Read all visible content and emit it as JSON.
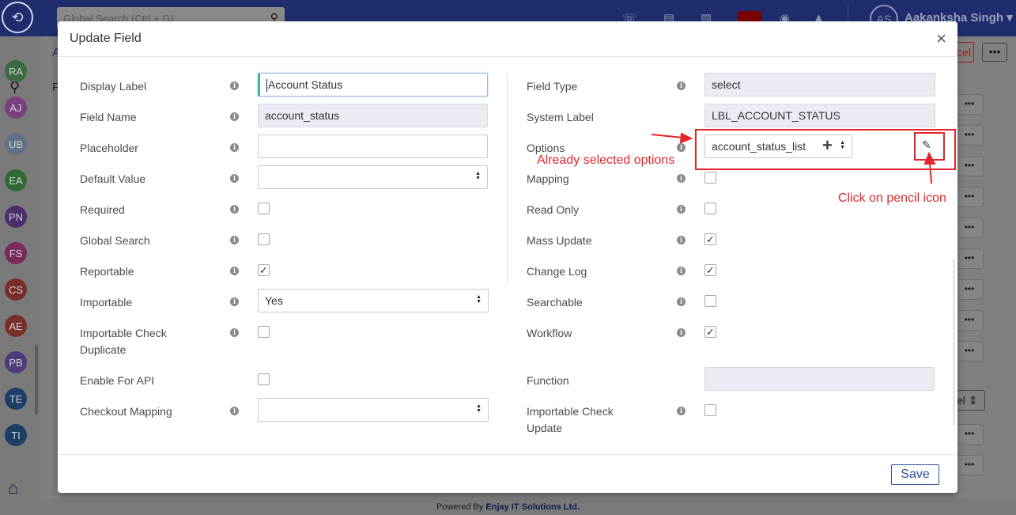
{
  "app": {
    "search_placeholder": "Global Search (Ctrl + G)",
    "user_initials": "AS",
    "user_name": "Aakanksha Singh",
    "footer_prefix": "Powered By",
    "footer_company": "Enjay IT Solutions Ltd.",
    "bg_tab_partial": "A",
    "bg_title_partial": "F",
    "bg_cancel_partial": "cel",
    "bg_select_partial": "el",
    "sidebar_avatars": [
      {
        "initials": "RA",
        "color": "#3b6b43"
      },
      {
        "initials": "AJ",
        "color": "#7a3f7e"
      },
      {
        "initials": "UB",
        "color": "#5f7186"
      },
      {
        "initials": "EA",
        "color": "#2f6a35"
      },
      {
        "initials": "PN",
        "color": "#4e2d6b"
      },
      {
        "initials": "FS",
        "color": "#7a2a5c"
      },
      {
        "initials": "CS",
        "color": "#7a2e2a"
      },
      {
        "initials": "AE",
        "color": "#7a2e2a"
      },
      {
        "initials": "PB",
        "color": "#4e3a7a"
      },
      {
        "initials": "TE",
        "color": "#1d3f66"
      },
      {
        "initials": "TI",
        "color": "#1d3f66"
      }
    ]
  },
  "modal": {
    "title": "Update Field",
    "close_symbol": "×",
    "save_label": "Save",
    "left_fields": {
      "display_label": {
        "label": "Display Label",
        "value": "Account Status"
      },
      "field_name": {
        "label": "Field Name",
        "value": "account_status"
      },
      "placeholder": {
        "label": "Placeholder",
        "value": ""
      },
      "default_value": {
        "label": "Default Value",
        "value": ""
      },
      "required": {
        "label": "Required",
        "checked": false
      },
      "global_search": {
        "label": "Global Search",
        "checked": false
      },
      "reportable": {
        "label": "Reportable",
        "checked": true
      },
      "importable": {
        "label": "Importable",
        "value": "Yes"
      },
      "importable_check_duplicate": {
        "label_line1": "Importable Check",
        "label_line2": "Duplicate",
        "checked": false
      },
      "enable_for_api": {
        "label": "Enable For API",
        "checked": false
      },
      "checkout_mapping": {
        "label": "Checkout Mapping",
        "value": ""
      }
    },
    "right_fields": {
      "field_type": {
        "label": "Field Type",
        "value": "select"
      },
      "system_label": {
        "label": "System Label",
        "value": "LBL_ACCOUNT_STATUS"
      },
      "options": {
        "label": "Options",
        "value": "account_status_list",
        "add_symbol": "+"
      },
      "mapping": {
        "label": "Mapping",
        "checked": false
      },
      "read_only": {
        "label": "Read Only",
        "checked": false
      },
      "mass_update": {
        "label": "Mass Update",
        "checked": true
      },
      "change_log": {
        "label": "Change Log",
        "checked": true
      },
      "searchable": {
        "label": "Searchable",
        "checked": false
      },
      "workflow": {
        "label": "Workflow",
        "checked": true
      },
      "function": {
        "label": "Function",
        "value": ""
      },
      "importable_check_update": {
        "label_line1": "Importable Check",
        "label_line2": "Update",
        "checked": false
      }
    }
  },
  "annotations": {
    "selected_options_note": "Already selected options",
    "pencil_note": "Click on pencil icon",
    "color": "#e0262b"
  }
}
